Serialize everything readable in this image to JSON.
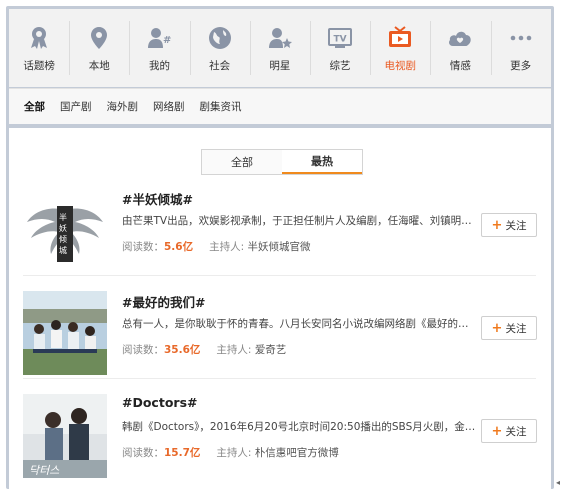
{
  "categories": [
    {
      "label": "话题榜",
      "icon": "award-ribbon-icon"
    },
    {
      "label": "本地",
      "icon": "location-pin-icon"
    },
    {
      "label": "我的",
      "icon": "user-hash-icon"
    },
    {
      "label": "社会",
      "icon": "globe-icon"
    },
    {
      "label": "明星",
      "icon": "star-person-icon"
    },
    {
      "label": "综艺",
      "icon": "tv-icon"
    },
    {
      "label": "电视剧",
      "icon": "tv-play-icon",
      "active": true
    },
    {
      "label": "情感",
      "icon": "heart-cloud-icon"
    },
    {
      "label": "更多",
      "icon": "more-dots-icon"
    }
  ],
  "subtabs": [
    "全部",
    "国产剧",
    "海外剧",
    "网络剧",
    "剧集资讯"
  ],
  "segment": [
    "全部",
    "最热"
  ],
  "items": [
    {
      "title": "#半妖倾城#",
      "desc": "由芒果TV出品，欢娱影视承制，于正担任制片人及编剧，任海曜、刘镇明…",
      "reads_label": "阅读数：",
      "reads": "5.6亿",
      "host_label": "主持人:",
      "host": "半妖倾城官微",
      "follow": "关注"
    },
    {
      "title": "#最好的我们#",
      "desc": "总有一人，是你耿耿于怀的青春。八月长安同名小说改编网络剧《最好的…",
      "reads_label": "阅读数：",
      "reads": "35.6亿",
      "host_label": "主持人:",
      "host": "爱奇艺",
      "follow": "关注"
    },
    {
      "title": "#Doctors#",
      "desc": "韩剧《Doctors》，2016年6月20号北京时间20:50播出的SBS月火剧，金来…",
      "reads_label": "阅读数：",
      "reads": "15.7亿",
      "host_label": "主持人:",
      "host": "朴信惠吧官方微博",
      "follow": "关注"
    }
  ],
  "colors": {
    "accent": "#ea5a22",
    "icon_gray": "#8a94a6",
    "frame": "#c3cbd7"
  }
}
